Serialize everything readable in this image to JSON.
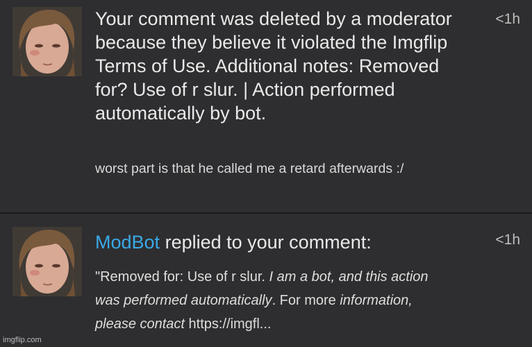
{
  "notifications": [
    {
      "message": "Your comment was deleted by a moderator because they believe it violated the Imgflip Terms of Use. Additional notes: Removed for? Use of r slur. | Action performed automatically by bot.",
      "comment": "worst part is that he called me a retard afterwards :/",
      "time": "<1h"
    },
    {
      "actor": "ModBot",
      "action": "replied to your comment:",
      "reply_prefix": "\"Removed for: Use of r slur. ",
      "reply_italic": "I am a bot, and this action was performed automatically",
      "reply_middle": ". For more ",
      "reply_italic2": "information, please contact",
      "reply_suffix": " https://imgfl...",
      "time": "<1h"
    }
  ],
  "watermark": "imgflip.com",
  "colors": {
    "background": "#2e2e30",
    "divider": "#1a1a1a",
    "accent": "#3aa9e8"
  }
}
